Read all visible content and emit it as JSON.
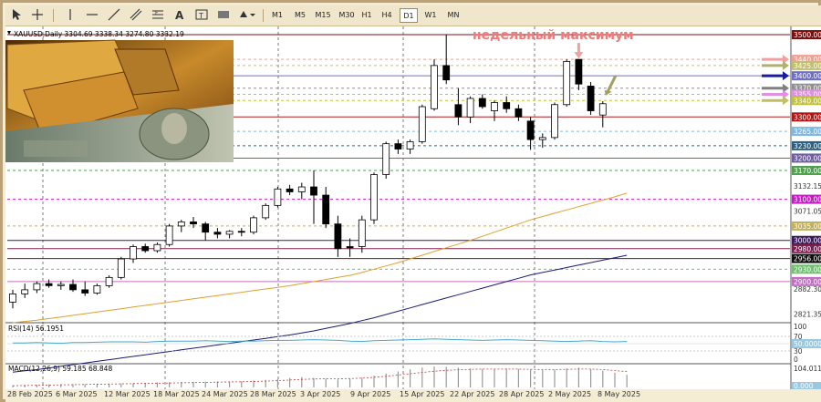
{
  "toolbar": {
    "timeframes": [
      "M1",
      "M5",
      "M15",
      "M30",
      "H1",
      "H4",
      "D1",
      "W1",
      "MN"
    ],
    "active_timeframe": "D1"
  },
  "symbol_header": "XAUUSD,Daily  3304.69 3338.34 3274.80 3332.19",
  "annotation": "недельный максимум",
  "colors": {
    "bull": "#ffffff",
    "bear": "#000000",
    "ma_fast": "#e0a030",
    "ma_slow": "#1a1a7a",
    "rsi": "#4aa8c8",
    "macd": "#999999",
    "macd_signal": "#c04040"
  },
  "price_levels": [
    {
      "label": "3500.00",
      "bg": "#7a1010",
      "fg": "#ffffff",
      "line": "#7a1010",
      "style": "solid"
    },
    {
      "label": "3440.00",
      "bg": "#f0a090",
      "fg": "#ffffff",
      "line": "#f0a090",
      "style": "dashed"
    },
    {
      "label": "3425.00",
      "bg": "#c0c070",
      "fg": "#ffffff",
      "line": "#c0c070",
      "style": "dashed"
    },
    {
      "label": "3400.00",
      "bg": "#7070c0",
      "fg": "#ffffff",
      "line": "#7070c0",
      "style": "solid"
    },
    {
      "label": "3370.00",
      "bg": "#909090",
      "fg": "#ffffff",
      "line": "#909090",
      "style": "dashed"
    },
    {
      "label": "3355.00",
      "bg": "#e090e0",
      "fg": "#ffffff",
      "line": "#e090e0",
      "style": "dashed"
    },
    {
      "label": "3340.00",
      "bg": "#c0c040",
      "fg": "#ffffff",
      "line": "#c0c040",
      "style": "dashed"
    },
    {
      "label": "3300.00",
      "bg": "#b01818",
      "fg": "#ffffff",
      "line": "#b01818",
      "style": "solid"
    },
    {
      "label": "3265.00",
      "bg": "#80b8e0",
      "fg": "#ffffff",
      "line": "#80b8e0",
      "style": "dashed"
    },
    {
      "label": "3230.00",
      "bg": "#306080",
      "fg": "#ffffff",
      "line": "#306080",
      "style": "dashed"
    },
    {
      "label": "3200.00",
      "bg": "#7060a0",
      "fg": "#ffffff",
      "line": "#7060a0",
      "style": "solid"
    },
    {
      "label": "3170.00",
      "bg": "#50a050",
      "fg": "#ffffff",
      "line": "#50a050",
      "style": "dashed"
    },
    {
      "label": "3100.00",
      "bg": "#c020c0",
      "fg": "#ffffff",
      "line": "#c020c0",
      "style": "dashed"
    },
    {
      "label": "3035.00",
      "bg": "#c0b060",
      "fg": "#ffffff",
      "line": "#c0b060",
      "style": "dashed"
    },
    {
      "label": "3000.00",
      "bg": "#3a1a5a",
      "fg": "#ffffff",
      "line": "#3a1a5a",
      "style": "solid"
    },
    {
      "label": "2980.00",
      "bg": "#7a2050",
      "fg": "#ffffff",
      "line": "#7a2050",
      "style": "solid"
    },
    {
      "label": "2956.00",
      "bg": "#101010",
      "fg": "#ffffff",
      "line": "#7a1010",
      "style": "solid"
    },
    {
      "label": "2930.00",
      "bg": "#70c070",
      "fg": "#ffffff",
      "line": "#70c070",
      "style": "dashed"
    },
    {
      "label": "2900.00",
      "bg": "#c070c0",
      "fg": "#ffffff",
      "line": "#c070c0",
      "style": "solid"
    }
  ],
  "price_ticks": [
    "3132.15",
    "3071.05",
    "2882.30",
    "2821.35"
  ],
  "rsi": {
    "label": "RSI(14) 56.1951",
    "scale": [
      "100",
      "70",
      "50.0000",
      "30",
      "0"
    ],
    "values": [
      52,
      52,
      53,
      52,
      51,
      53,
      53,
      54,
      55,
      55,
      55,
      54,
      56,
      57,
      57,
      57,
      58,
      57,
      56,
      57,
      57,
      58,
      59,
      59,
      60,
      61,
      60,
      59,
      57,
      56,
      58,
      59,
      60,
      61,
      62,
      63,
      62,
      61,
      60,
      59,
      60,
      61,
      60,
      59,
      58,
      57,
      56,
      57,
      58,
      56,
      55,
      56
    ]
  },
  "macd": {
    "label": "MACD(12,26,9) 59.185 68.848",
    "scale": [
      "104.011",
      "0.000"
    ],
    "hist": [
      10,
      12,
      13,
      14,
      15,
      15,
      16,
      17,
      18,
      19,
      20,
      22,
      24,
      25,
      26,
      26,
      27,
      28,
      28,
      30,
      33,
      36,
      40,
      45,
      49,
      45,
      42,
      38,
      40,
      46,
      56,
      66,
      76,
      86,
      95,
      100,
      98,
      94,
      90,
      88,
      89,
      90,
      88,
      85,
      82,
      84,
      90,
      94,
      88,
      80,
      70,
      60
    ],
    "signal": [
      8,
      9,
      10,
      11,
      12,
      13,
      14,
      15,
      16,
      17,
      18,
      19,
      20,
      21,
      22,
      23,
      24,
      25,
      26,
      27,
      28,
      30,
      32,
      35,
      38,
      40,
      41,
      41,
      42,
      44,
      48,
      53,
      59,
      65,
      71,
      77,
      81,
      84,
      86,
      87,
      87,
      87,
      87,
      86,
      85,
      85,
      86,
      87,
      87,
      85,
      80,
      75
    ]
  },
  "ma_fast": [
    2800,
    2803,
    2806,
    2810,
    2814,
    2818,
    2822,
    2826,
    2830,
    2834,
    2838,
    2842,
    2846,
    2850,
    2854,
    2858,
    2862,
    2866,
    2870,
    2874,
    2878,
    2882,
    2886,
    2890,
    2895,
    2900,
    2905,
    2910,
    2915,
    2922,
    2930,
    2938,
    2946,
    2955,
    2964,
    2973,
    2982,
    2991,
    3000,
    3010,
    3020,
    3030,
    3040,
    3050,
    3058,
    3066,
    3074,
    3082,
    3090,
    3098,
    3106,
    3115
  ],
  "ma_slow": [
    2680,
    2683,
    2686,
    2690,
    2694,
    2698,
    2702,
    2706,
    2710,
    2714,
    2718,
    2722,
    2726,
    2730,
    2734,
    2738,
    2742,
    2746,
    2750,
    2754,
    2758,
    2762,
    2766,
    2770,
    2775,
    2780,
    2786,
    2792,
    2798,
    2805,
    2812,
    2820,
    2828,
    2836,
    2844,
    2852,
    2860,
    2868,
    2876,
    2884,
    2892,
    2900,
    2908,
    2916,
    2922,
    2928,
    2934,
    2940,
    2946,
    2952,
    2958,
    2964
  ],
  "candles": [
    {
      "o": 2850,
      "h": 2880,
      "l": 2835,
      "c": 2870
    },
    {
      "o": 2870,
      "h": 2895,
      "l": 2860,
      "c": 2880
    },
    {
      "o": 2880,
      "h": 2900,
      "l": 2872,
      "c": 2895
    },
    {
      "o": 2895,
      "h": 2905,
      "l": 2885,
      "c": 2890
    },
    {
      "o": 2890,
      "h": 2900,
      "l": 2880,
      "c": 2893
    },
    {
      "o": 2893,
      "h": 2905,
      "l": 2875,
      "c": 2880
    },
    {
      "o": 2880,
      "h": 2900,
      "l": 2865,
      "c": 2872
    },
    {
      "o": 2872,
      "h": 2895,
      "l": 2868,
      "c": 2890
    },
    {
      "o": 2890,
      "h": 2915,
      "l": 2885,
      "c": 2910
    },
    {
      "o": 2910,
      "h": 2960,
      "l": 2905,
      "c": 2955
    },
    {
      "o": 2955,
      "h": 2990,
      "l": 2945,
      "c": 2985
    },
    {
      "o": 2985,
      "h": 2992,
      "l": 2970,
      "c": 2975
    },
    {
      "o": 2975,
      "h": 2995,
      "l": 2970,
      "c": 2990
    },
    {
      "o": 2990,
      "h": 3040,
      "l": 2985,
      "c": 3035
    },
    {
      "o": 3035,
      "h": 3050,
      "l": 3020,
      "c": 3045
    },
    {
      "o": 3045,
      "h": 3057,
      "l": 3030,
      "c": 3040
    },
    {
      "o": 3040,
      "h": 3045,
      "l": 3000,
      "c": 3020
    },
    {
      "o": 3020,
      "h": 3030,
      "l": 3005,
      "c": 3015
    },
    {
      "o": 3015,
      "h": 3025,
      "l": 3005,
      "c": 3022
    },
    {
      "o": 3022,
      "h": 3030,
      "l": 3010,
      "c": 3020
    },
    {
      "o": 3020,
      "h": 3060,
      "l": 3015,
      "c": 3055
    },
    {
      "o": 3055,
      "h": 3090,
      "l": 3050,
      "c": 3085
    },
    {
      "o": 3085,
      "h": 3130,
      "l": 3080,
      "c": 3125
    },
    {
      "o": 3125,
      "h": 3135,
      "l": 3110,
      "c": 3118
    },
    {
      "o": 3118,
      "h": 3140,
      "l": 3100,
      "c": 3130
    },
    {
      "o": 3130,
      "h": 3170,
      "l": 3040,
      "c": 3110
    },
    {
      "o": 3110,
      "h": 3130,
      "l": 3030,
      "c": 3040
    },
    {
      "o": 3040,
      "h": 3060,
      "l": 2960,
      "c": 2980
    },
    {
      "o": 2985,
      "h": 3005,
      "l": 2960,
      "c": 2982
    },
    {
      "o": 2985,
      "h": 3060,
      "l": 2970,
      "c": 3050
    },
    {
      "o": 3050,
      "h": 3165,
      "l": 3040,
      "c": 3160
    },
    {
      "o": 3160,
      "h": 3240,
      "l": 3150,
      "c": 3235
    },
    {
      "o": 3235,
      "h": 3245,
      "l": 3210,
      "c": 3222
    },
    {
      "o": 3222,
      "h": 3245,
      "l": 3210,
      "c": 3240
    },
    {
      "o": 3240,
      "h": 3330,
      "l": 3235,
      "c": 3325
    },
    {
      "o": 3320,
      "h": 3440,
      "l": 3315,
      "c": 3425
    },
    {
      "o": 3425,
      "h": 3500,
      "l": 3380,
      "c": 3390
    },
    {
      "o": 3330,
      "h": 3370,
      "l": 3280,
      "c": 3300
    },
    {
      "o": 3300,
      "h": 3350,
      "l": 3285,
      "c": 3345
    },
    {
      "o": 3345,
      "h": 3355,
      "l": 3320,
      "c": 3325
    },
    {
      "o": 3315,
      "h": 3340,
      "l": 3290,
      "c": 3335
    },
    {
      "o": 3335,
      "h": 3350,
      "l": 3310,
      "c": 3320
    },
    {
      "o": 3320,
      "h": 3330,
      "l": 3290,
      "c": 3300
    },
    {
      "o": 3290,
      "h": 3300,
      "l": 3220,
      "c": 3245
    },
    {
      "o": 3245,
      "h": 3260,
      "l": 3225,
      "c": 3250
    },
    {
      "o": 3250,
      "h": 3335,
      "l": 3245,
      "c": 3330
    },
    {
      "o": 3330,
      "h": 3440,
      "l": 3325,
      "c": 3435
    },
    {
      "o": 3440,
      "h": 3440,
      "l": 3365,
      "c": 3380
    },
    {
      "o": 3375,
      "h": 3385,
      "l": 3305,
      "c": 3315
    },
    {
      "o": 3304.69,
      "h": 3338.34,
      "l": 3274.8,
      "c": 3332.19
    }
  ],
  "date_labels": [
    "28 Feb 2025",
    "6 Mar 2025",
    "12 Mar 2025",
    "18 Mar 2025",
    "24 Mar 2025",
    "28 Mar 2025",
    "3 Apr 2025",
    "9 Apr 2025",
    "15 Apr 2025",
    "22 Apr 2025",
    "28 Apr 2025",
    "2 May 2025",
    "8 May 2025"
  ],
  "arrows": [
    {
      "color": "#f0a0a0",
      "target": "3440.00"
    },
    {
      "color": "#b0b070",
      "target": "3425.00"
    },
    {
      "color": "#1a1a9a",
      "target": "3400.00"
    },
    {
      "color": "#808080",
      "target": "3370.00"
    },
    {
      "color": "#e090e0",
      "target": "3355.00"
    },
    {
      "color": "#c0c060",
      "target": "3340.00"
    }
  ]
}
